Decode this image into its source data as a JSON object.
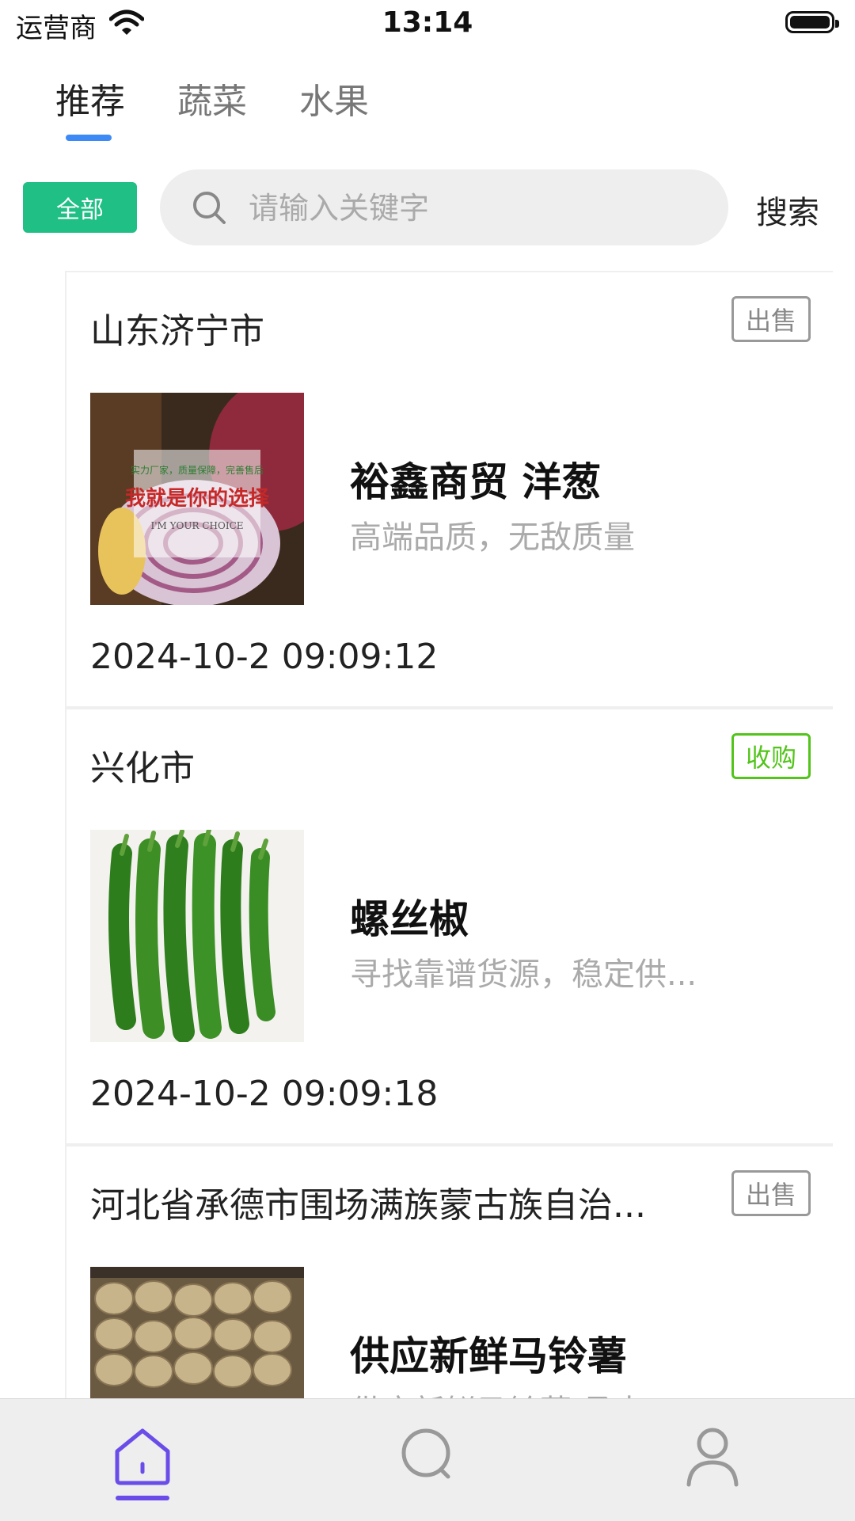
{
  "status_bar": {
    "carrier": "运营商",
    "time": "13:14"
  },
  "tabs": [
    {
      "label": "推荐"
    },
    {
      "label": "蔬菜"
    },
    {
      "label": "水果"
    }
  ],
  "filter": {
    "all_label": "全部"
  },
  "search": {
    "placeholder": "请输入关键字",
    "button_label": "搜索"
  },
  "listings": [
    {
      "location": "山东济宁市",
      "tag": "出售",
      "title": "裕鑫商贸 洋葱",
      "subtitle": "高端品质，无敌质量",
      "time": "2024-10-2 09:09:12",
      "image_text": {
        "line1": "实力厂家，质量保障，完善售后",
        "line2": "我就是你的选择",
        "line3": "I'M YOUR CHOICE"
      }
    },
    {
      "location": "兴化市",
      "tag": "收购",
      "title": "螺丝椒",
      "subtitle": "寻找靠谱货源，稳定供...",
      "time": "2024-10-2 09:09:18"
    },
    {
      "location": "河北省承德市围场满族蒙古族自治...",
      "tag": "出售",
      "title": "供应新鲜马铃薯",
      "subtitle": "供应新鲜马铃薯 承杰",
      "time": ""
    }
  ],
  "bottom_nav": {
    "items": [
      {
        "icon": "home-icon",
        "active": true
      },
      {
        "icon": "search-icon",
        "active": false
      },
      {
        "icon": "user-icon",
        "active": false
      }
    ],
    "active_color": "#6a4de8"
  },
  "colors": {
    "accent_tab": "#3d8af7",
    "all_button": "#1fbf85",
    "buy_tag": "#52c41a",
    "sell_tag": "#999999"
  }
}
